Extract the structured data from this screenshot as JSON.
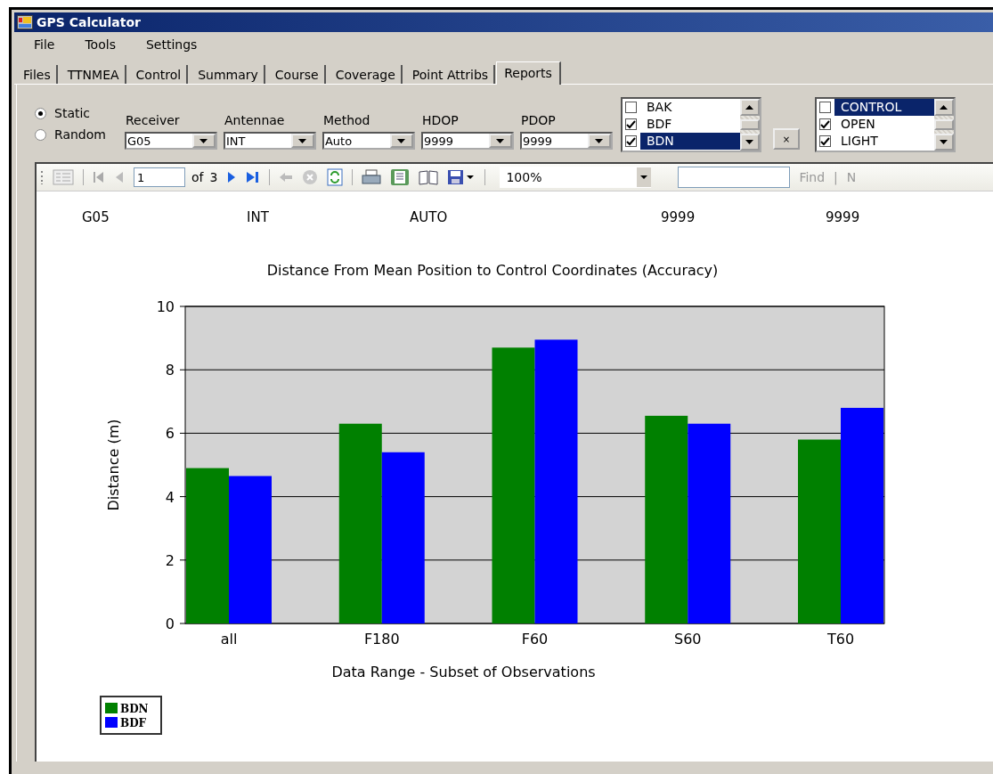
{
  "window": {
    "title": "GPS Calculator"
  },
  "menu": [
    "File",
    "Tools",
    "Settings"
  ],
  "tabs": [
    {
      "label": "Files",
      "selected": false
    },
    {
      "label": "TTNMEA",
      "selected": false
    },
    {
      "label": "Control",
      "selected": false
    },
    {
      "label": "Summary",
      "selected": false
    },
    {
      "label": "Course",
      "selected": false
    },
    {
      "label": "Coverage",
      "selected": false
    },
    {
      "label": "Point Attribs",
      "selected": false
    },
    {
      "label": "Reports",
      "selected": true
    }
  ],
  "mode_options": [
    {
      "label": "Static",
      "selected": true
    },
    {
      "label": "Random",
      "selected": false
    }
  ],
  "dropdowns": [
    {
      "label": "Receiver",
      "value": "G05"
    },
    {
      "label": "Antennae",
      "value": "INT"
    },
    {
      "label": "Method",
      "value": "Auto"
    },
    {
      "label": "HDOP",
      "value": "9999"
    },
    {
      "label": "PDOP",
      "value": "9999"
    }
  ],
  "list_1": [
    {
      "label": "BAK",
      "checked": false,
      "selected": false
    },
    {
      "label": "BDF",
      "checked": true,
      "selected": false
    },
    {
      "label": "BDN",
      "checked": true,
      "selected": true
    }
  ],
  "clear_button": "×",
  "list_2": [
    {
      "label": "CONTROL",
      "checked": false,
      "selected": true
    },
    {
      "label": "OPEN",
      "checked": true,
      "selected": false
    },
    {
      "label": "LIGHT",
      "checked": true,
      "selected": false
    }
  ],
  "report_toolbar": {
    "page": "1",
    "of": "of",
    "total": "3",
    "zoom": "100%",
    "find": "Find",
    "separator": "|",
    "next": "N"
  },
  "report": {
    "header_values": [
      "G05",
      "INT",
      "AUTO",
      "9999",
      "9999"
    ],
    "chart_data": {
      "type": "bar",
      "title": "Distance From Mean Position to Control Coordinates (Accuracy)",
      "xlabel": "Data Range - Subset of Observations",
      "ylabel": "Distance (m)",
      "categories": [
        "all",
        "F180",
        "F60",
        "S60",
        "T60"
      ],
      "series": [
        {
          "name": "BDN",
          "color": "#008000",
          "values": [
            4.9,
            6.3,
            8.7,
            6.55,
            5.8
          ]
        },
        {
          "name": "BDF",
          "color": "#0000ff",
          "values": [
            4.65,
            5.4,
            8.95,
            6.3,
            6.8
          ]
        }
      ],
      "ylim": [
        0,
        10
      ],
      "yticks": [
        0,
        2,
        4,
        6,
        8,
        10
      ],
      "grid": true,
      "legend": true
    }
  }
}
